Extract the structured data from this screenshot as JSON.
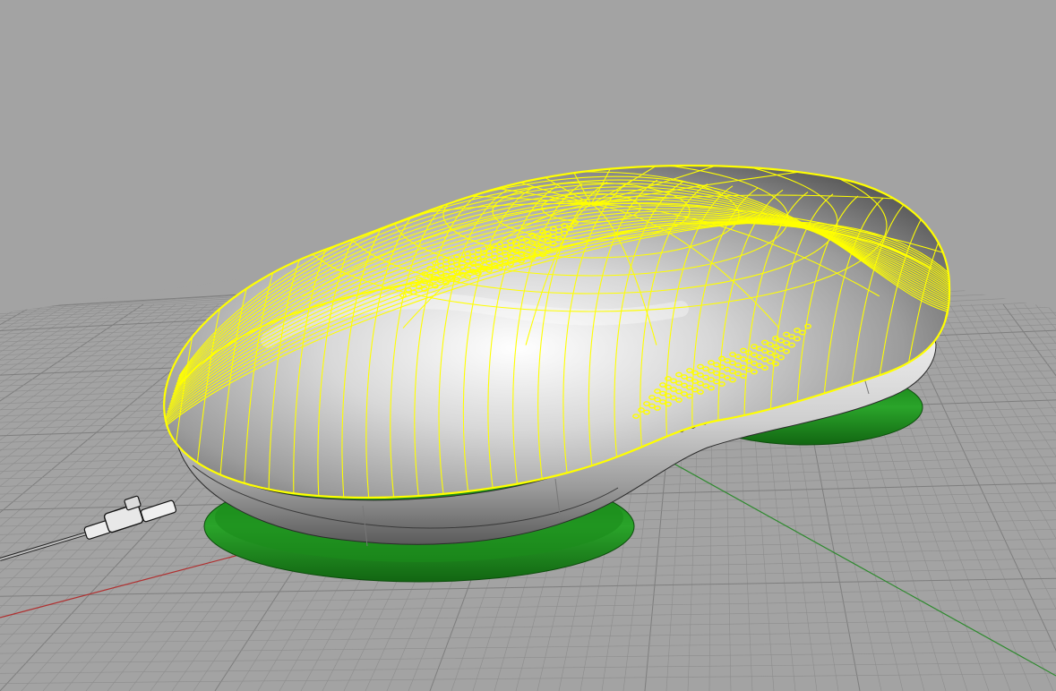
{
  "viewport": {
    "background_color": "#a3a3a3",
    "grid_color": "#8d8d8d",
    "grid_major_color": "#7e7e7e",
    "x_axis_color": "#b03030",
    "y_axis_color": "#2e8a2e",
    "selection_wire_color": "#ffff00",
    "base_ring_color": "#1f9a1f",
    "shell_color": "#d6d6d6"
  },
  "scene": {
    "object": "bean-shaped-device",
    "selected_part": "top-shell",
    "accessory": "cable-connector"
  }
}
